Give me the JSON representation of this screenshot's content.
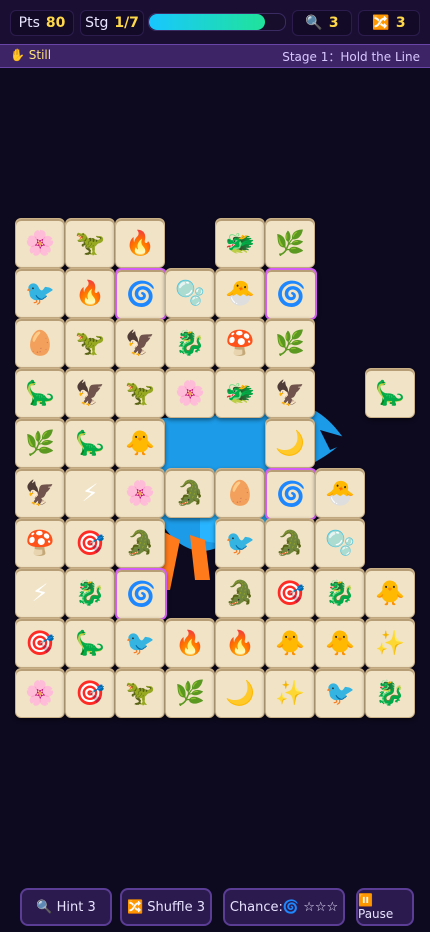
{
  "hud": {
    "points_label": "Pts",
    "points_value": "80",
    "stage_label": "Stg",
    "stage_value": "1/7",
    "progress_fraction": 0.85,
    "hint_count": "3",
    "shuffle_count": "3",
    "hint_icon": "magnifier-icon",
    "shuffle_icon": "shuffle-icon"
  },
  "status": {
    "mode_text": "✋ Still",
    "stage_text": "Stage 1：Hold the Line"
  },
  "tiles": [
    {
      "r": 0,
      "c": 0,
      "icon": "🌸",
      "name": "cherry-blossom"
    },
    {
      "r": 0,
      "c": 1,
      "icon": "🦖",
      "name": "t-rex"
    },
    {
      "r": 0,
      "c": 2,
      "icon": "🔥",
      "name": "fire"
    },
    {
      "r": 0,
      "c": 4,
      "icon": "🐲",
      "name": "dragon-face"
    },
    {
      "r": 0,
      "c": 5,
      "icon": "🌿",
      "name": "herb"
    },
    {
      "r": 1,
      "c": 0,
      "icon": "🐦",
      "name": "bird"
    },
    {
      "r": 1,
      "c": 1,
      "icon": "🔥",
      "name": "fire"
    },
    {
      "r": 1,
      "c": 2,
      "icon": "🌀",
      "name": "cyclone",
      "hl": true
    },
    {
      "r": 1,
      "c": 3,
      "icon": "🫧",
      "name": "bubbles"
    },
    {
      "r": 1,
      "c": 4,
      "icon": "🐣",
      "name": "hatching-chick"
    },
    {
      "r": 1,
      "c": 5,
      "icon": "🌀",
      "name": "cyclone",
      "hl": true
    },
    {
      "r": 2,
      "c": 0,
      "icon": "🥚",
      "name": "egg"
    },
    {
      "r": 2,
      "c": 1,
      "icon": "🦖",
      "name": "t-rex"
    },
    {
      "r": 2,
      "c": 2,
      "icon": "🦅",
      "name": "eagle"
    },
    {
      "r": 2,
      "c": 3,
      "icon": "🐉",
      "name": "dragon"
    },
    {
      "r": 2,
      "c": 4,
      "icon": "🍄",
      "name": "mushroom"
    },
    {
      "r": 2,
      "c": 5,
      "icon": "🌿",
      "name": "herb"
    },
    {
      "r": 3,
      "c": 0,
      "icon": "🦕",
      "name": "sauropod"
    },
    {
      "r": 3,
      "c": 1,
      "icon": "🦅",
      "name": "eagle"
    },
    {
      "r": 3,
      "c": 2,
      "icon": "🦖",
      "name": "t-rex"
    },
    {
      "r": 3,
      "c": 3,
      "icon": "🌸",
      "name": "cherry-blossom"
    },
    {
      "r": 3,
      "c": 4,
      "icon": "🐲",
      "name": "dragon-face"
    },
    {
      "r": 3,
      "c": 5,
      "icon": "🦅",
      "name": "eagle"
    },
    {
      "r": 3,
      "c": 7,
      "icon": "🦕",
      "name": "sauropod"
    },
    {
      "r": 4,
      "c": 0,
      "icon": "🌿",
      "name": "herb"
    },
    {
      "r": 4,
      "c": 1,
      "icon": "🦕",
      "name": "sauropod"
    },
    {
      "r": 4,
      "c": 2,
      "icon": "🐥",
      "name": "chick"
    },
    {
      "r": 4,
      "c": 5,
      "icon": "🌙",
      "name": "crescent-moon"
    },
    {
      "r": 5,
      "c": 0,
      "icon": "🦅",
      "name": "eagle"
    },
    {
      "r": 5,
      "c": 1,
      "icon": "⚡",
      "name": "lightning"
    },
    {
      "r": 5,
      "c": 2,
      "icon": "🌸",
      "name": "cherry-blossom"
    },
    {
      "r": 5,
      "c": 3,
      "icon": "🐊",
      "name": "crocodile"
    },
    {
      "r": 5,
      "c": 4,
      "icon": "🥚",
      "name": "egg"
    },
    {
      "r": 5,
      "c": 5,
      "icon": "🌀",
      "name": "cyclone",
      "hl": true
    },
    {
      "r": 5,
      "c": 6,
      "icon": "🐣",
      "name": "hatching-chick"
    },
    {
      "r": 6,
      "c": 0,
      "icon": "🍄",
      "name": "mushroom"
    },
    {
      "r": 6,
      "c": 1,
      "icon": "🎯",
      "name": "target"
    },
    {
      "r": 6,
      "c": 2,
      "icon": "🐊",
      "name": "crocodile"
    },
    {
      "r": 6,
      "c": 4,
      "icon": "🐦",
      "name": "bird"
    },
    {
      "r": 6,
      "c": 5,
      "icon": "🐊",
      "name": "crocodile"
    },
    {
      "r": 6,
      "c": 6,
      "icon": "🫧",
      "name": "bubbles"
    },
    {
      "r": 7,
      "c": 0,
      "icon": "⚡",
      "name": "lightning"
    },
    {
      "r": 7,
      "c": 1,
      "icon": "🐉",
      "name": "dragon"
    },
    {
      "r": 7,
      "c": 2,
      "icon": "🌀",
      "name": "cyclone",
      "hl": true
    },
    {
      "r": 7,
      "c": 4,
      "icon": "🐊",
      "name": "crocodile"
    },
    {
      "r": 7,
      "c": 5,
      "icon": "🎯",
      "name": "target"
    },
    {
      "r": 7,
      "c": 6,
      "icon": "🐉",
      "name": "dragon"
    },
    {
      "r": 7,
      "c": 7,
      "icon": "🐥",
      "name": "chick"
    },
    {
      "r": 8,
      "c": 0,
      "icon": "🎯",
      "name": "target"
    },
    {
      "r": 8,
      "c": 1,
      "icon": "🦕",
      "name": "sauropod"
    },
    {
      "r": 8,
      "c": 2,
      "icon": "🐦",
      "name": "bird"
    },
    {
      "r": 8,
      "c": 3,
      "icon": "🔥",
      "name": "fire"
    },
    {
      "r": 8,
      "c": 4,
      "icon": "🔥",
      "name": "fire"
    },
    {
      "r": 8,
      "c": 5,
      "icon": "🐥",
      "name": "chick"
    },
    {
      "r": 8,
      "c": 6,
      "icon": "🐥",
      "name": "chick"
    },
    {
      "r": 8,
      "c": 7,
      "icon": "✨",
      "name": "sparkles"
    },
    {
      "r": 9,
      "c": 0,
      "icon": "🌸",
      "name": "cherry-blossom"
    },
    {
      "r": 9,
      "c": 1,
      "icon": "🎯",
      "name": "target"
    },
    {
      "r": 9,
      "c": 2,
      "icon": "🦖",
      "name": "t-rex"
    },
    {
      "r": 9,
      "c": 3,
      "icon": "🌿",
      "name": "herb"
    },
    {
      "r": 9,
      "c": 4,
      "icon": "🌙",
      "name": "crescent-moon"
    },
    {
      "r": 9,
      "c": 5,
      "icon": "✨",
      "name": "sparkles"
    },
    {
      "r": 9,
      "c": 6,
      "icon": "🐦",
      "name": "bird"
    },
    {
      "r": 9,
      "c": 7,
      "icon": "🐉",
      "name": "dragon"
    }
  ],
  "buttons": {
    "hint_label": "🔍 Hint 3",
    "shuffle_label": "🔀 Shuffle 3",
    "chance_label": "Chance:🌀 ☆☆☆",
    "pause_label": "⏸️ Pause"
  },
  "colors": {
    "tile_face": "#f1e3c5",
    "highlight": "#d35cf5",
    "points_accent": "#ffd84a",
    "progress_start": "#18c7ff",
    "progress_end": "#20e39a"
  }
}
